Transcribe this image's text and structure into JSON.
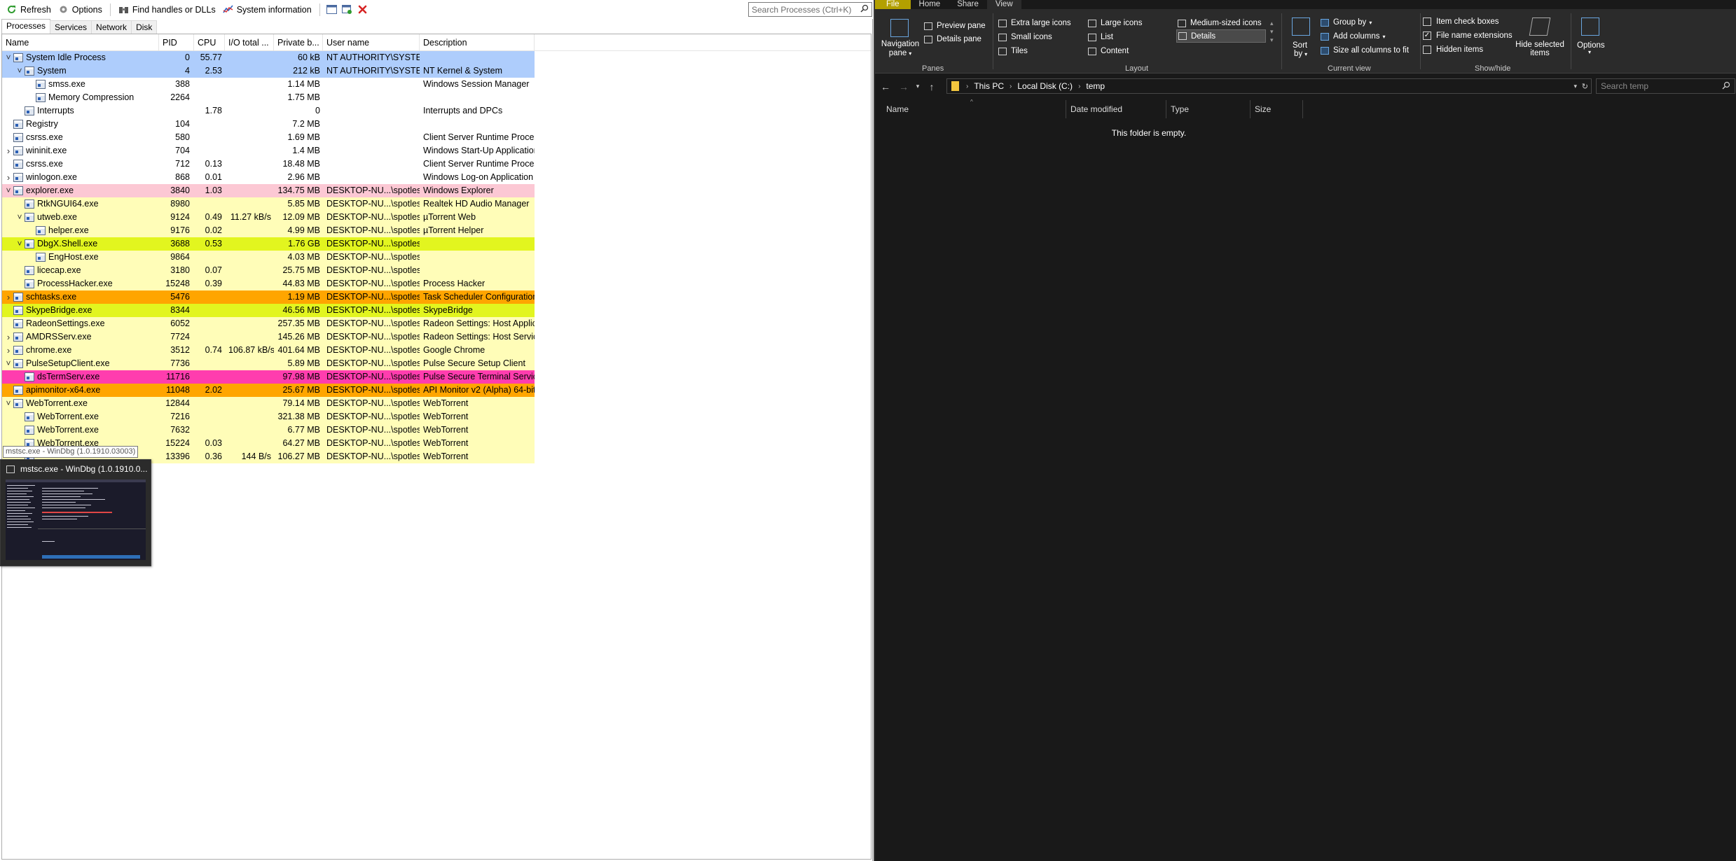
{
  "toolbar": {
    "refresh": "Refresh",
    "options": "Options",
    "find_handles": "Find handles or DLLs",
    "system_info": "System information",
    "search_placeholder": "Search Processes (Ctrl+K)"
  },
  "tabs": [
    "Processes",
    "Services",
    "Network",
    "Disk"
  ],
  "columns": [
    "Name",
    "PID",
    "CPU",
    "I/O total ...",
    "Private b...",
    "User name",
    "Description"
  ],
  "colors": {
    "system_blue": "#aecdfc",
    "service_pink": "#fcc8d4",
    "own_yellow": "#fffdb8",
    "dotnet_lime": "#e2f51f",
    "suspended_orange": "#ffa500",
    "magenta": "#ff3dae",
    "explorer_bg": "#191919",
    "ribbon_bg": "#2b2b2b"
  },
  "processes": [
    {
      "name": "System Idle Process",
      "pid": "0",
      "cpu": "55.77",
      "io": "",
      "priv": "60 kB",
      "user": "NT AUTHORITY\\SYSTEM",
      "desc": "",
      "depth": 0,
      "exp": "v",
      "bg": "#aecdfc"
    },
    {
      "name": "System",
      "pid": "4",
      "cpu": "2.53",
      "io": "",
      "priv": "212 kB",
      "user": "NT AUTHORITY\\SYSTEM",
      "desc": "NT Kernel & System",
      "depth": 1,
      "exp": "v",
      "bg": "#aecdfc"
    },
    {
      "name": "smss.exe",
      "pid": "388",
      "cpu": "",
      "io": "",
      "priv": "1.14 MB",
      "user": "",
      "desc": "Windows Session Manager",
      "depth": 2,
      "exp": "",
      "bg": ""
    },
    {
      "name": "Memory Compression",
      "pid": "2264",
      "cpu": "",
      "io": "",
      "priv": "1.75 MB",
      "user": "",
      "desc": "",
      "depth": 2,
      "exp": "",
      "bg": ""
    },
    {
      "name": "Interrupts",
      "pid": "",
      "cpu": "1.78",
      "io": "",
      "priv": "0",
      "user": "",
      "desc": "Interrupts and DPCs",
      "depth": 1,
      "exp": "",
      "bg": ""
    },
    {
      "name": "Registry",
      "pid": "104",
      "cpu": "",
      "io": "",
      "priv": "7.2 MB",
      "user": "",
      "desc": "",
      "depth": 0,
      "exp": "",
      "bg": ""
    },
    {
      "name": "csrss.exe",
      "pid": "580",
      "cpu": "",
      "io": "",
      "priv": "1.69 MB",
      "user": "",
      "desc": "Client Server Runtime Process",
      "depth": 0,
      "exp": "",
      "bg": ""
    },
    {
      "name": "wininit.exe",
      "pid": "704",
      "cpu": "",
      "io": "",
      "priv": "1.4 MB",
      "user": "",
      "desc": "Windows Start-Up Application",
      "depth": 0,
      "exp": ">",
      "bg": ""
    },
    {
      "name": "csrss.exe",
      "pid": "712",
      "cpu": "0.13",
      "io": "",
      "priv": "18.48 MB",
      "user": "",
      "desc": "Client Server Runtime Process",
      "depth": 0,
      "exp": "",
      "bg": ""
    },
    {
      "name": "winlogon.exe",
      "pid": "868",
      "cpu": "0.01",
      "io": "",
      "priv": "2.96 MB",
      "user": "",
      "desc": "Windows Log-on Application",
      "depth": 0,
      "exp": ">",
      "bg": ""
    },
    {
      "name": "explorer.exe",
      "pid": "3840",
      "cpu": "1.03",
      "io": "",
      "priv": "134.75 MB",
      "user": "DESKTOP-NU...\\spotless",
      "desc": "Windows Explorer",
      "depth": 0,
      "exp": "v",
      "bg": "#fcc8d4"
    },
    {
      "name": "RtkNGUI64.exe",
      "pid": "8980",
      "cpu": "",
      "io": "",
      "priv": "5.85 MB",
      "user": "DESKTOP-NU...\\spotless",
      "desc": "Realtek HD Audio Manager",
      "depth": 1,
      "exp": "",
      "bg": "#fffdb8"
    },
    {
      "name": "utweb.exe",
      "pid": "9124",
      "cpu": "0.49",
      "io": "11.27 kB/s",
      "priv": "12.09 MB",
      "user": "DESKTOP-NU...\\spotless",
      "desc": "µTorrent Web",
      "depth": 1,
      "exp": "v",
      "bg": "#fffdb8"
    },
    {
      "name": "helper.exe",
      "pid": "9176",
      "cpu": "0.02",
      "io": "",
      "priv": "4.99 MB",
      "user": "DESKTOP-NU...\\spotless",
      "desc": "µTorrent Helper",
      "depth": 2,
      "exp": "",
      "bg": "#fffdb8"
    },
    {
      "name": "DbgX.Shell.exe",
      "pid": "3688",
      "cpu": "0.53",
      "io": "",
      "priv": "1.76 GB",
      "user": "DESKTOP-NU...\\spotless",
      "desc": "",
      "depth": 1,
      "exp": "v",
      "bg": "#e2f51f"
    },
    {
      "name": "EngHost.exe",
      "pid": "9864",
      "cpu": "",
      "io": "",
      "priv": "4.03 MB",
      "user": "DESKTOP-NU...\\spotless",
      "desc": "",
      "depth": 2,
      "exp": "",
      "bg": "#fffdb8"
    },
    {
      "name": "licecap.exe",
      "pid": "3180",
      "cpu": "0.07",
      "io": "",
      "priv": "25.75 MB",
      "user": "DESKTOP-NU...\\spotless",
      "desc": "",
      "depth": 1,
      "exp": "",
      "bg": "#fffdb8"
    },
    {
      "name": "ProcessHacker.exe",
      "pid": "15248",
      "cpu": "0.39",
      "io": "",
      "priv": "44.83 MB",
      "user": "DESKTOP-NU...\\spotless",
      "desc": "Process Hacker",
      "depth": 1,
      "exp": "",
      "bg": "#fffdb8"
    },
    {
      "name": "schtasks.exe",
      "pid": "5476",
      "cpu": "",
      "io": "",
      "priv": "1.19 MB",
      "user": "DESKTOP-NU...\\spotless",
      "desc": "Task Scheduler Configuration ...",
      "depth": 0,
      "exp": ">",
      "bg": "#ffa500"
    },
    {
      "name": "SkypeBridge.exe",
      "pid": "8344",
      "cpu": "",
      "io": "",
      "priv": "46.56 MB",
      "user": "DESKTOP-NU...\\spotless",
      "desc": "SkypeBridge",
      "depth": 0,
      "exp": "",
      "bg": "#e2f51f"
    },
    {
      "name": "RadeonSettings.exe",
      "pid": "6052",
      "cpu": "",
      "io": "",
      "priv": "257.35 MB",
      "user": "DESKTOP-NU...\\spotless",
      "desc": "Radeon Settings: Host Applica...",
      "depth": 0,
      "exp": "",
      "bg": "#fffdb8"
    },
    {
      "name": "AMDRSServ.exe",
      "pid": "7724",
      "cpu": "",
      "io": "",
      "priv": "145.26 MB",
      "user": "DESKTOP-NU...\\spotless",
      "desc": "Radeon Settings: Host Service",
      "depth": 0,
      "exp": ">",
      "bg": "#fffdb8"
    },
    {
      "name": "chrome.exe",
      "pid": "3512",
      "cpu": "0.74",
      "io": "106.87 kB/s",
      "priv": "401.64 MB",
      "user": "DESKTOP-NU...\\spotless",
      "desc": "Google Chrome",
      "depth": 0,
      "exp": ">",
      "bg": "#fffdb8"
    },
    {
      "name": "PulseSetupClient.exe",
      "pid": "7736",
      "cpu": "",
      "io": "",
      "priv": "5.89 MB",
      "user": "DESKTOP-NU...\\spotless",
      "desc": "Pulse Secure Setup Client",
      "depth": 0,
      "exp": "v",
      "bg": "#fffdb8"
    },
    {
      "name": "dsTermServ.exe",
      "pid": "11716",
      "cpu": "",
      "io": "",
      "priv": "97.98 MB",
      "user": "DESKTOP-NU...\\spotless",
      "desc": "Pulse Secure Terminal Services...",
      "depth": 1,
      "exp": "",
      "bg": "#ff3dae"
    },
    {
      "name": "apimonitor-x64.exe",
      "pid": "11048",
      "cpu": "2.02",
      "io": "",
      "priv": "25.67 MB",
      "user": "DESKTOP-NU...\\spotless",
      "desc": "API Monitor v2 (Alpha) 64-bit",
      "depth": 0,
      "exp": "",
      "bg": "#ffa500"
    },
    {
      "name": "WebTorrent.exe",
      "pid": "12844",
      "cpu": "",
      "io": "",
      "priv": "79.14 MB",
      "user": "DESKTOP-NU...\\spotless",
      "desc": "WebTorrent",
      "depth": 0,
      "exp": "v",
      "bg": "#fffdb8"
    },
    {
      "name": "WebTorrent.exe",
      "pid": "7216",
      "cpu": "",
      "io": "",
      "priv": "321.38 MB",
      "user": "DESKTOP-NU...\\spotless",
      "desc": "WebTorrent",
      "depth": 1,
      "exp": "",
      "bg": "#fffdb8"
    },
    {
      "name": "WebTorrent.exe",
      "pid": "7632",
      "cpu": "",
      "io": "",
      "priv": "6.77 MB",
      "user": "DESKTOP-NU...\\spotless",
      "desc": "WebTorrent",
      "depth": 1,
      "exp": "",
      "bg": "#fffdb8"
    },
    {
      "name": "WebTorrent.exe",
      "pid": "15224",
      "cpu": "0.03",
      "io": "",
      "priv": "64.27 MB",
      "user": "DESKTOP-NU...\\spotless",
      "desc": "WebTorrent",
      "depth": 1,
      "exp": "",
      "bg": "#fffdb8"
    },
    {
      "name": "",
      "pid": "13396",
      "cpu": "0.36",
      "io": "144 B/s",
      "priv": "106.27 MB",
      "user": "DESKTOP-NU...\\spotless",
      "desc": "WebTorrent",
      "depth": 1,
      "exp": "",
      "bg": "#fffdb8"
    }
  ],
  "thumbnail": {
    "tooltip": "mstsc.exe - WinDbg (1.0.1910.03003)",
    "title": "mstsc.exe - WinDbg (1.0.1910.0..."
  },
  "explorer": {
    "tabs": [
      "File",
      "Home",
      "Share",
      "View"
    ],
    "ribbon": {
      "navigation_pane": "Navigation",
      "navigation_pane2": "pane",
      "preview_pane": "Preview pane",
      "details_pane": "Details pane",
      "panes_label": "Panes",
      "layout_items": [
        "Extra large icons",
        "Large icons",
        "Medium-sized icons",
        "Small icons",
        "List",
        "Details",
        "Tiles",
        "Content"
      ],
      "layout_label": "Layout",
      "sort_by": "Sort",
      "sort_by2": "by",
      "group_by": "Group by",
      "add_columns": "Add columns",
      "size_all_columns": "Size all columns to fit",
      "current_view_label": "Current view",
      "item_check_boxes": "Item check boxes",
      "file_name_extensions": "File name extensions",
      "hidden_items": "Hidden items",
      "hide_selected": "Hide selected",
      "hide_selected2": "items",
      "show_hide_label": "Show/hide",
      "options": "Options"
    },
    "breadcrumb": [
      "This PC",
      "Local Disk (C:)",
      "temp"
    ],
    "search_placeholder": "Search temp",
    "columns": [
      "Name",
      "Date modified",
      "Type",
      "Size"
    ],
    "empty_message": "This folder is empty."
  }
}
